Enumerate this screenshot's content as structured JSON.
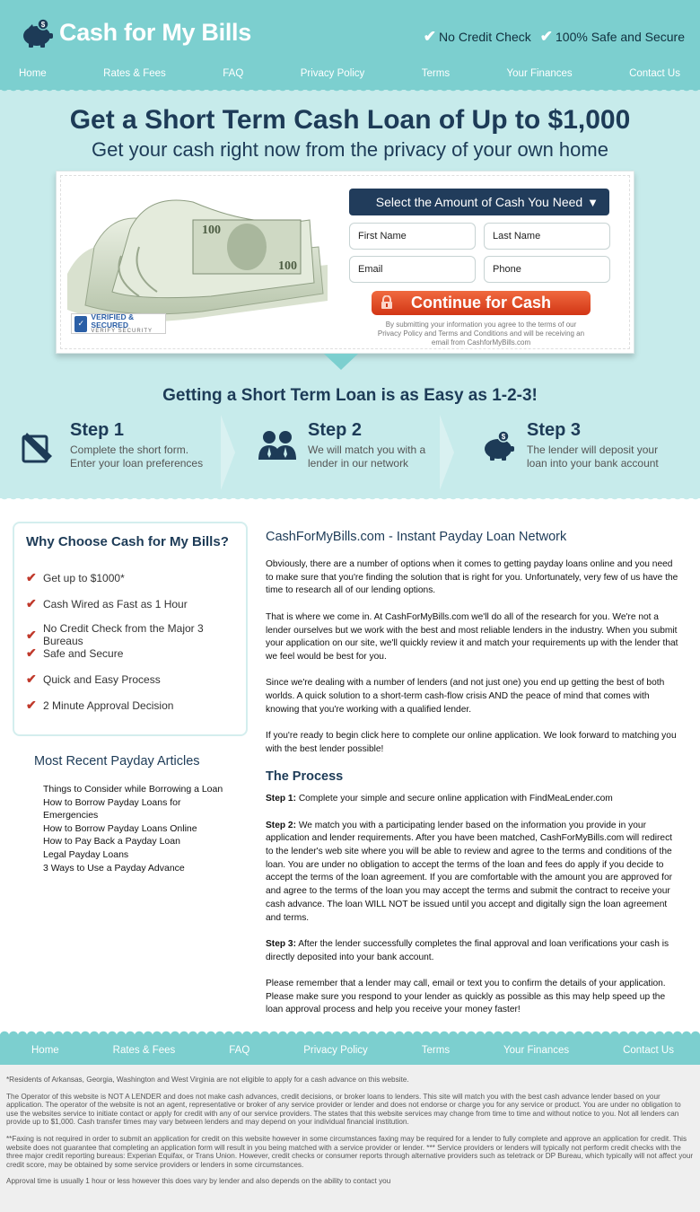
{
  "brand": {
    "name": "Cash for My Bills"
  },
  "header_badges": [
    "No Credit Check",
    "100% Safe and Secure"
  ],
  "nav": [
    "Home",
    "Rates & Fees",
    "FAQ",
    "Privacy Policy",
    "Terms",
    "Your Finances",
    "Contact Us"
  ],
  "hero": {
    "title": "Get a Short Term Cash Loan of Up to $1,000",
    "subtitle": "Get your cash right now from the privacy of your own home"
  },
  "form": {
    "amount_select": "Select the Amount of Cash You Need",
    "first_name": "First Name",
    "last_name": "Last Name",
    "email": "Email",
    "phone": "Phone",
    "submit": "Continue for Cash",
    "disclaimer": "By submitting your information you agree to the terms of our Privacy Policy and Terms and Conditions and will be receiving an email from CashforMyBills.com",
    "verified_line1": "VERIFIED & SECURED",
    "verified_line2": "VERIFY SECURITY"
  },
  "steps_title": "Getting a Short Term Loan is as Easy as 1-2-3!",
  "steps": [
    {
      "title": "Step 1",
      "text": "Complete the short form. Enter your loan preferences"
    },
    {
      "title": "Step 2",
      "text": "We will match you with a lender in our network"
    },
    {
      "title": "Step 3",
      "text": "The lender will deposit your loan into your bank account"
    }
  ],
  "why": {
    "title": "Why Choose Cash for My Bills?",
    "items": [
      "Get up to $1000*",
      "Cash Wired as Fast as 1 Hour",
      "No Credit Check from the Major 3 Bureaus",
      "Safe and Secure",
      "Quick and Easy Process",
      "2 Minute Approval Decision"
    ]
  },
  "articles": {
    "title": "Most Recent Payday Articles",
    "items": [
      "Things to Consider while Borrowing a Loan",
      "How to Borrow Payday Loans for Emergencies",
      "How to Borrow Payday Loans Online",
      "How to Pay Back a Payday Loan",
      "Legal Payday Loans",
      "3 Ways to Use a Payday Advance"
    ]
  },
  "content": {
    "heading": "CashForMyBills.com - Instant Payday Loan Network",
    "paragraphs": [
      "Obviously, there are a number of options when it comes to getting payday loans online and you need to make sure that you're finding the solution that is right for you. Unfortunately, very few of us have the time to research all of our lending options.",
      "That is where we come in. At CashForMyBills.com we'll do all of the research for you. We're not a lender ourselves but we work with the best and most reliable lenders in the industry. When you submit your application on our site, we'll quickly review it and match your requirements up with the lender that we feel would be best for you.",
      "Since we're dealing with a number of lenders (and not just one) you end up getting the best of both worlds. A quick solution to a short-term cash-flow crisis AND the peace of mind that comes with knowing that you're working with a qualified lender.",
      "If you're ready to begin click here to complete our online application. We look forward to matching you with the best lender possible!"
    ],
    "process_heading": "The Process",
    "process": [
      {
        "label": "Step 1:",
        "text": "Complete your simple and secure online application with FindMeaLender.com"
      },
      {
        "label": "Step 2:",
        "text": "We match you with a participating lender based on the information you provide in your application and lender requirements. After you have been matched, CashForMyBills.com will redirect to the lender's web site where you will be able to review and agree to the terms and conditions of the loan. You are under no obligation to accept the terms of the loan and fees do apply if you decide to accept the terms of the loan agreement. If you are comfortable with the amount you are approved for and agree to the terms of the loan you may accept the terms and submit the contract to receive your cash advance. The loan WILL NOT be issued until you accept and digitally sign the loan agreement and terms."
      },
      {
        "label": "Step 3:",
        "text": "After the lender successfully completes the final approval and loan verifications your cash is directly deposited into your bank account."
      }
    ],
    "closing": "Please remember that a lender may call, email or text you to confirm the details of your application. Please make sure you respond to your lender as quickly as possible as this may help speed up the loan approval process and help you receive your money faster!"
  },
  "legal": [
    "*Residents of Arkansas, Georgia, Washington and West Virginia are not eligible to apply for a cash advance on this website.",
    "The Operator of this website is NOT A LENDER and does not make cash advances, credit decisions, or broker loans to lenders. This site will match you with the best cash advance lender based on your application. The operator of the website is not an agent, representative or broker of any service provider or lender and does not endorse or charge you for any service or product. You are under no obligation to use the websites service to initiate contact or apply for credit with any of our service providers. The states that this website services may change from time to time and without notice to you. Not all lenders can provide up to $1,000. Cash transfer times may vary between lenders and may depend on your individual financial institution.",
    "**Faxing is not required in order to submit an application for credit on this website however in some circumstances faxing may be required for a lender to fully complete and approve an application for credit. This website does not guarantee that completing an application form will result in you being matched with a service provider or lender. *** Service providers or lenders will typically not perform credit checks with the three major credit reporting bureaus: Experian Equifax, or Trans Union. However, credit checks or consumer reports through alternative providers such as teletrack or DP Bureau, which typically will not affect your credit score, may be obtained by some service providers or lenders in some circumstances.",
    "Approval time is usually 1 hour or less however this does vary by lender and also depends on the ability to contact you"
  ],
  "colors": {
    "header": "#7ccfcf",
    "hero": "#c7ebeb",
    "navy": "#1d3b57",
    "cta": "#e04a24"
  }
}
